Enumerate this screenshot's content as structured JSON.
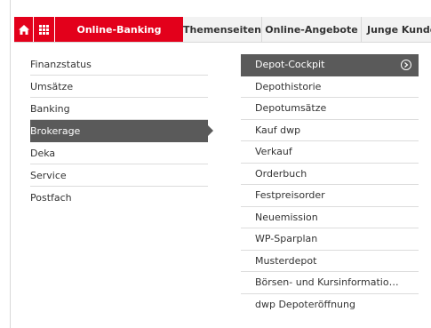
{
  "nav": {
    "home_icon": "home-icon",
    "grid_icon": "grid-icon",
    "items": [
      {
        "label": "Online-Banking"
      },
      {
        "label": "Themenseiten"
      },
      {
        "label": "Online-Angebote"
      },
      {
        "label": "Junge Kunde"
      }
    ],
    "accent_color": "#e3001b"
  },
  "left_menu": {
    "items": [
      {
        "label": "Finanzstatus"
      },
      {
        "label": "Umsätze"
      },
      {
        "label": "Banking"
      },
      {
        "label": "Brokerage",
        "active": true
      },
      {
        "label": "Deka"
      },
      {
        "label": "Service"
      },
      {
        "label": "Postfach"
      }
    ]
  },
  "right_menu": {
    "items": [
      {
        "label": "Depot-Cockpit",
        "active": true,
        "icon": "chevron-circle-icon"
      },
      {
        "label": "Depothistorie"
      },
      {
        "label": "Depotumsätze"
      },
      {
        "label": "Kauf dwp"
      },
      {
        "label": "Verkauf"
      },
      {
        "label": "Orderbuch"
      },
      {
        "label": "Festpreisorder"
      },
      {
        "label": "Neuemission"
      },
      {
        "label": "WP-Sparplan"
      },
      {
        "label": "Musterdepot"
      },
      {
        "label": "Börsen- und Kursinformatio…"
      },
      {
        "label": "dwp Depoteröffnung"
      }
    ]
  },
  "colors": {
    "active_bg": "#5a5a5a",
    "divider": "#dcdcdc"
  }
}
